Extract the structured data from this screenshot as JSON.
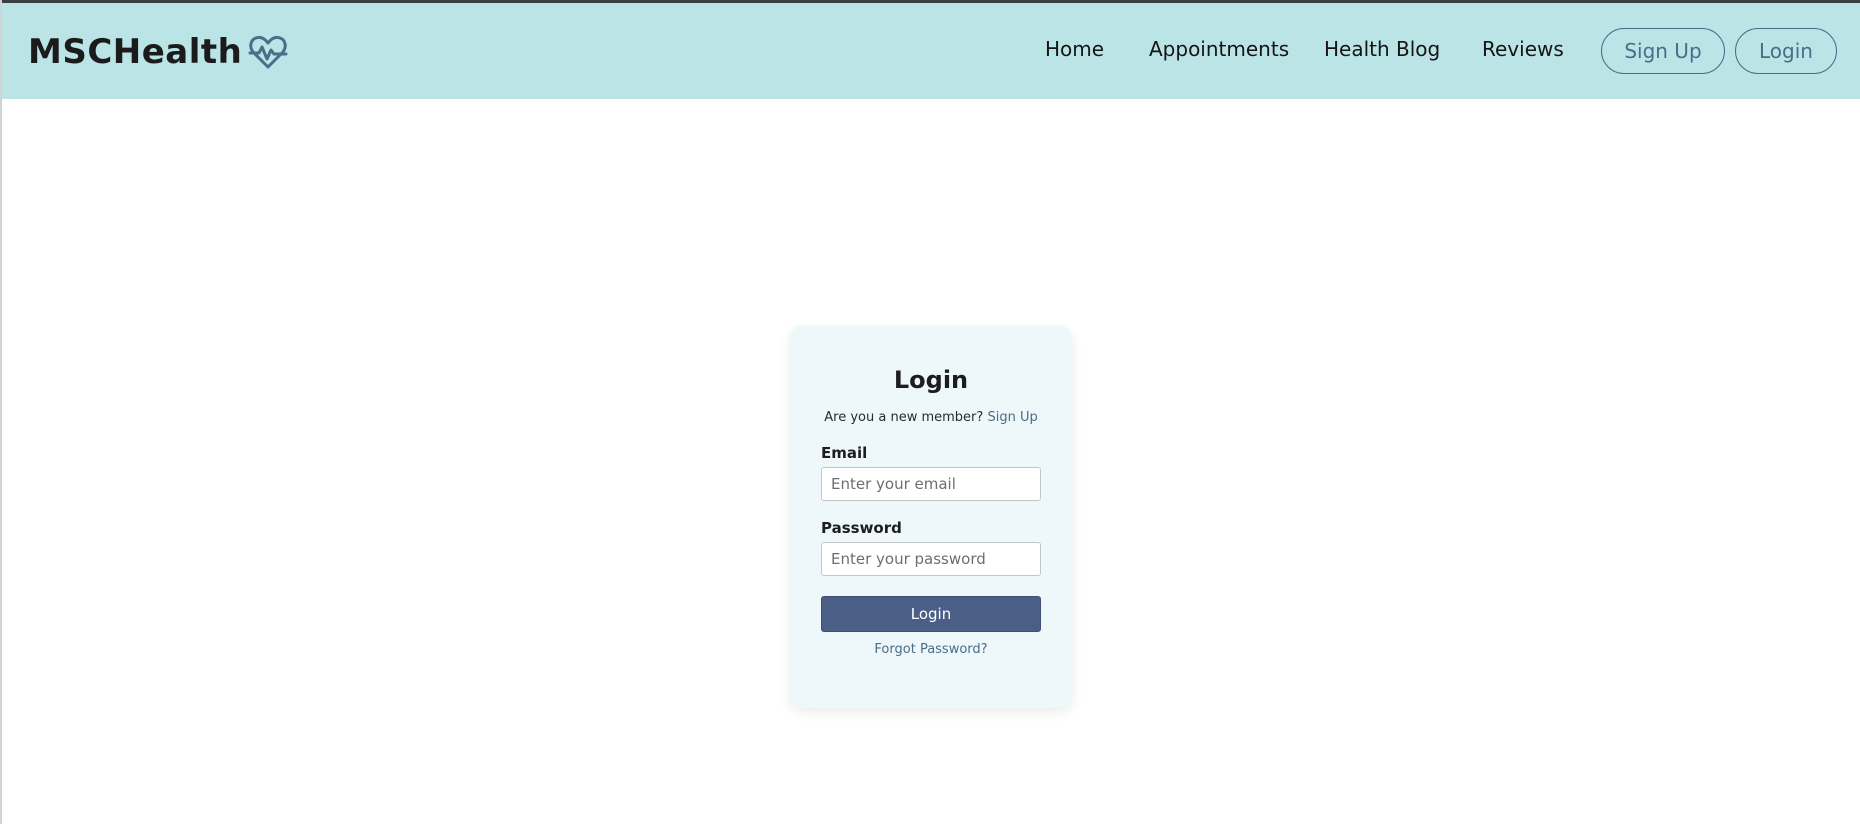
{
  "header": {
    "brand": "MSCHealth",
    "brand_icon": "heart-pulse-icon",
    "nav": [
      "Home",
      "Appointments",
      "Health Blog",
      "Reviews"
    ],
    "signup_label": "Sign Up",
    "login_label": "Login"
  },
  "login_form": {
    "title": "Login",
    "new_member_text": "Are you a new member?",
    "signup_link": "Sign Up",
    "email_label": "Email",
    "email_placeholder": "Enter your email",
    "password_label": "Password",
    "password_placeholder": "Enter your password",
    "submit_label": "Login",
    "forgot_label": "Forgot Password?"
  },
  "colors": {
    "navbar_bg": "#bbe4e7",
    "accent": "#4a6d88",
    "button_bg": "#4b5e86",
    "card_bg": "#eef7f9"
  }
}
